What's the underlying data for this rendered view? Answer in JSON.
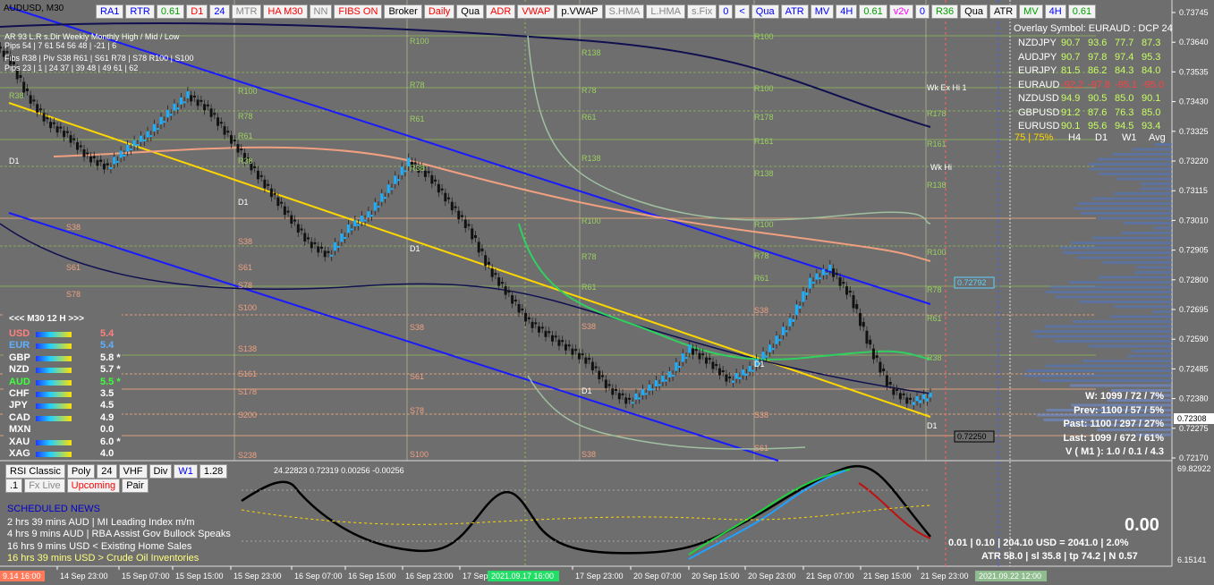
{
  "chart_data": {
    "type": "line",
    "symbol_label": "AUDUSD, M30",
    "x_ticks": [
      "14 Sep 23:00",
      "15 Sep 07:00",
      "15 Sep 15:00",
      "15 Sep 23:00",
      "16 Sep 07:00",
      "16 Sep 15:00",
      "16 Sep 23:00",
      "17 Sep 07:00",
      "17 Sep 23:00",
      "20 Sep 07:00",
      "20 Sep 15:00",
      "20 Sep 23:00",
      "21 Sep 07:00",
      "21 Sep 15:00",
      "21 Sep 23:00"
    ],
    "x_first_label": "9.14 16:00",
    "x_cursor_label": "2021.09.17 16:00",
    "x_last_label": "2021.09.22 12:00",
    "y_ticks": [
      "0.73745",
      "0.73640",
      "0.73535",
      "0.73430",
      "0.73325",
      "0.73220",
      "0.73115",
      "0.73010",
      "0.72905",
      "0.72800",
      "0.72695",
      "0.72590",
      "0.72485",
      "0.72380",
      "0.72275",
      "0.72170"
    ],
    "ylim": [
      0.7212,
      0.7378
    ],
    "bid_price": "0.72308",
    "line_price_1": "0.72792",
    "line_price_2": "0.72250",
    "close_series": [
      0.736,
      0.7345,
      0.7335,
      0.733,
      0.7322,
      0.7318,
      0.7325,
      0.733,
      0.7338,
      0.7345,
      0.734,
      0.733,
      0.732,
      0.731,
      0.73,
      0.729,
      0.7285,
      0.7295,
      0.73,
      0.731,
      0.732,
      0.7315,
      0.7305,
      0.7295,
      0.728,
      0.727,
      0.726,
      0.7255,
      0.725,
      0.7245,
      0.7235,
      0.723,
      0.7235,
      0.724,
      0.725,
      0.7245,
      0.7238,
      0.7242,
      0.725,
      0.726,
      0.7275,
      0.728,
      0.727,
      0.725,
      0.7235,
      0.723,
      0.7232
    ],
    "osc_ylim": [
      6.15141,
      69.82922
    ],
    "osc_ticks": [
      "69.82922",
      "6.15141"
    ],
    "osc_values": "24.22823 0.72319 0.00256 -0.00256"
  },
  "top_toolbar": [
    "RA1",
    "RTR",
    "0.61",
    "D1",
    "24",
    "MTR",
    "HA M30",
    "NN",
    "FIBS ON",
    "Broker",
    "Daily",
    "Qua",
    "ADR",
    "VWAP",
    "p.VWAP",
    "S.HMA",
    "L.HMA",
    "s.Fix",
    "0",
    "<",
    "Qua",
    "ATR",
    "MV",
    "4H",
    "0.61",
    "v2v",
    "0",
    "R36",
    "Qua",
    "ATR",
    "MV",
    "4H",
    "0.61"
  ],
  "bottom_toolbar": [
    "RSI Classic",
    "Poly",
    "24",
    "VHF",
    "Div",
    "W1",
    "1.28"
  ],
  "sub_toolbar": [
    ".1",
    "Fx Live",
    "Upcoming",
    "Pair"
  ],
  "stats_left": {
    "row1": "AR   93  L.R     s.Dir    Weekly   Monthly    High / Mid / Low",
    "row2": "Pips   54 | 7       61       54       56         48  | -21 |  6",
    "row3": "Fibs  R38 | Piv    S38      R61 | S61    R78 | S78    R100 | S100",
    "row4": "Pips   23  |  1  | 24        37 | 39       48 | 49       61 | 62"
  },
  "overlay": {
    "title": "Overlay Symbol: EURAUD : DCP 24",
    "rows": [
      {
        "pair": "NZDJPY",
        "v": [
          "90.7",
          "93.6",
          "77.7",
          "87.3"
        ]
      },
      {
        "pair": "AUDJPY",
        "v": [
          "90.7",
          "97.8",
          "97.4",
          "95.3"
        ]
      },
      {
        "pair": "EURJPY",
        "v": [
          "81.5",
          "86.2",
          "84.3",
          "84.0"
        ]
      },
      {
        "pair": "EURAUD",
        "v": [
          "-92.2",
          "-97.8",
          "-95.1",
          "-95.0"
        ]
      },
      {
        "pair": "NZDUSD",
        "v": [
          "94.9",
          "90.5",
          "85.0",
          "90.1"
        ]
      },
      {
        "pair": "GBPUSD",
        "v": [
          "91.2",
          "87.6",
          "76.3",
          "85.0"
        ]
      },
      {
        "pair": "EURUSD",
        "v": [
          "90.1",
          "95.6",
          "94.5",
          "93.4"
        ]
      }
    ],
    "footer_pct": "75 | 75%",
    "footer_cols": [
      "H4",
      "D1",
      "W1",
      "Avg"
    ]
  },
  "currency_panel": {
    "header": "<<<    M30   12  H    >>>",
    "rows": [
      {
        "name": "USD",
        "val": "5.4"
      },
      {
        "name": "EUR",
        "val": "5.4"
      },
      {
        "name": "GBP",
        "val": "5.8 *"
      },
      {
        "name": "NZD",
        "val": "5.7 *"
      },
      {
        "name": "AUD",
        "val": "5.5 *"
      },
      {
        "name": "CHF",
        "val": "3.5"
      },
      {
        "name": "JPY",
        "val": "4.5"
      },
      {
        "name": "CAD",
        "val": "4.9"
      },
      {
        "name": "MXN",
        "val": "0.0"
      },
      {
        "name": "XAU",
        "val": "6.0 *"
      },
      {
        "name": "XAG",
        "val": "4.0"
      }
    ]
  },
  "news": {
    "title": "SCHEDULED NEWS",
    "items": [
      "2 hrs 39 mins  AUD  |  MI Leading Index m/m",
      "4 hrs 9 mins  AUD  |  RBA Assist Gov Bullock Speaks",
      "16 hrs 9 mins  USD  <  Existing Home Sales",
      "16 hrs 39 mins  USD  >  Crude Oil Inventories"
    ]
  },
  "range_stats": [
    "W: 1099 / 72 / 7%",
    "Prev: 1100 / 57 / 5%",
    "Past: 1100 / 297 / 27%",
    "Last: 1099 / 672 / 61%",
    "V ( M1 ): 1.0 / 0.1 / 4.3"
  ],
  "bottom_stats": {
    "big": "0.00",
    "line1": "0.01  |  0.10  |  204.10 USD = 2041.0  |  2.0%",
    "line2": "ATR 58.0  |  sl 35.8  |  tp 74.2  |  N 0.57"
  },
  "chart_labels": {
    "wk_ex_hi": "Wk Ex Hi 1",
    "wk_hi": "Wk Hi",
    "r100": "R100",
    "r78": "R78",
    "r61": "R61",
    "r38": "R38",
    "d1": "D1",
    "s38": "S38",
    "s61": "S61",
    "s78": "S78",
    "s100": "S100",
    "s138": "S138",
    "s161": "S161",
    "s178": "S178",
    "s200": "S200",
    "s238": "S238",
    "r138": "R138",
    "r161": "R161",
    "r178": "R178"
  }
}
